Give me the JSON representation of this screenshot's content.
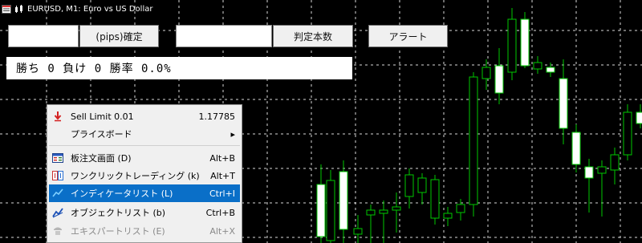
{
  "window": {
    "title": "EURUSD, M1:  Euro vs US Dollar"
  },
  "panel": {
    "pips_input_value": "",
    "pips_button_label": "(pips)確定",
    "count_input_value": "",
    "count_button_label": "判定本数",
    "alert_button_label": "アラート",
    "stats_text": "勝ち 0 負け 0 勝率 0.0%"
  },
  "context_menu": {
    "items": [
      {
        "label": "Sell Limit 0.01",
        "shortcut": "1.17785",
        "icon": "sell-limit-arrow-icon"
      },
      {
        "label": "プライスボード",
        "shortcut": "",
        "icon": "",
        "submenu_arrow": "▸"
      },
      {
        "label": "板注文画面 (D)",
        "shortcut": "Alt+B",
        "icon": "order-board-icon"
      },
      {
        "label": "ワンクリックトレーディング (k)",
        "shortcut": "Alt+T",
        "icon": "one-click-trading-icon"
      },
      {
        "label": "インディケータリスト (L)",
        "shortcut": "Ctrl+I",
        "icon": "indicator-list-icon",
        "highlighted": true
      },
      {
        "label": "オブジェクトリスト (b)",
        "shortcut": "Ctrl+B",
        "icon": "object-list-icon"
      },
      {
        "label": "エキスパートリスト (E)",
        "shortcut": "Alt+X",
        "icon": "expert-list-icon",
        "disabled": true
      }
    ]
  },
  "colors": {
    "chart_background": "#000000",
    "grid": "#ffffff",
    "candle_outline": "#00c800",
    "bull_body": "#000000",
    "bear_body": "#ffffff",
    "menu_highlight": "#0a6fc8"
  }
}
